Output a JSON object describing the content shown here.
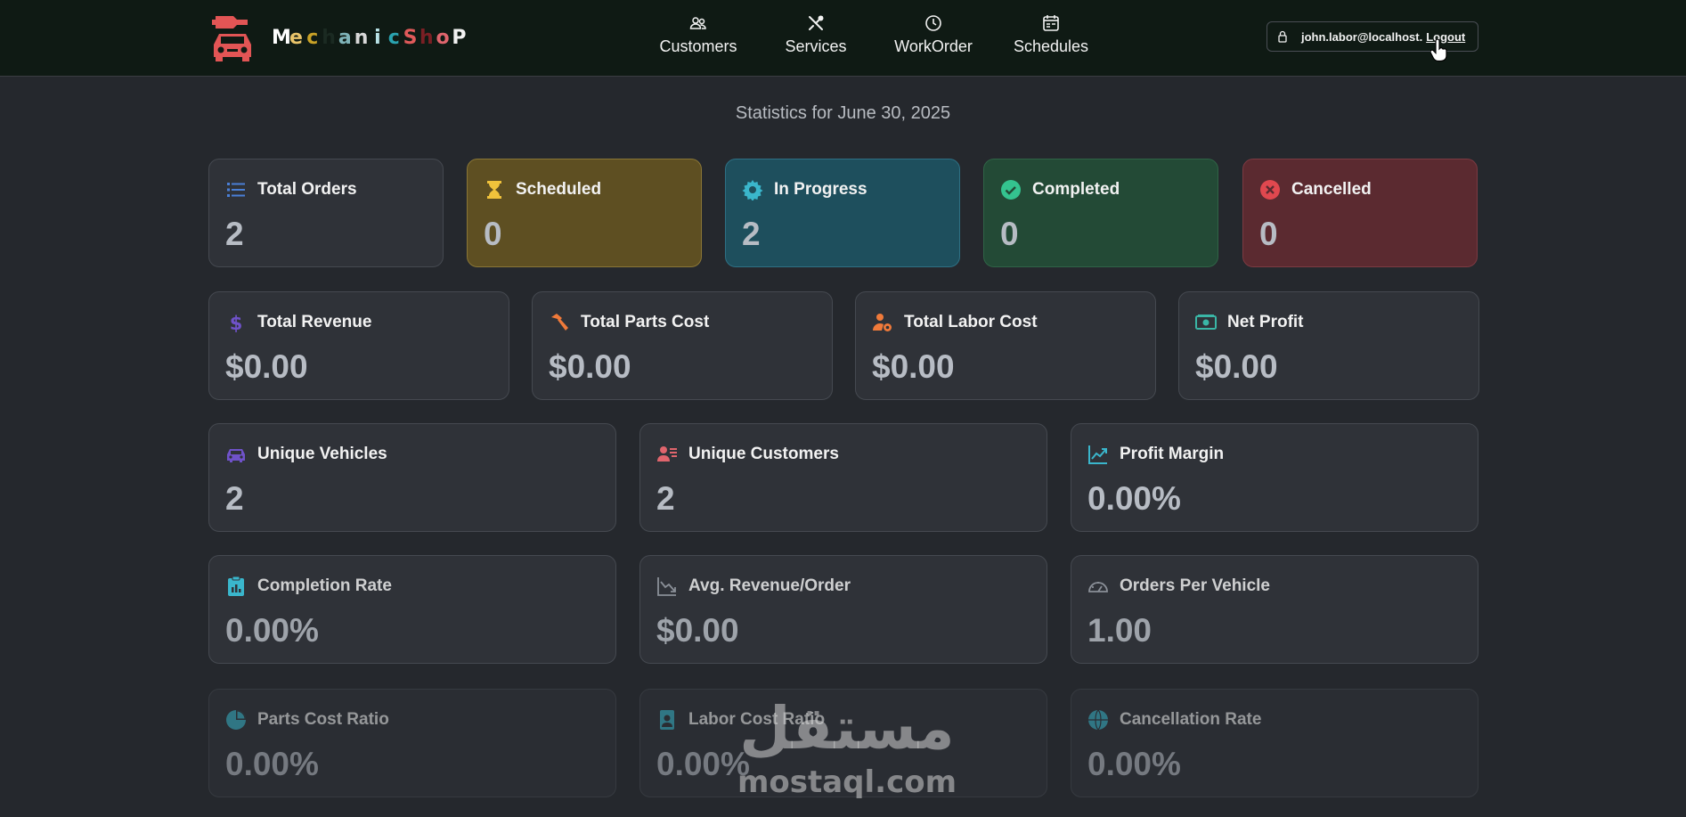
{
  "brand": {
    "letters": [
      {
        "ch": "M",
        "color": "#ffffff"
      },
      {
        "ch": "e",
        "color": "#e9c46a"
      },
      {
        "ch": "c",
        "color": "#c9a227"
      },
      {
        "ch": "h",
        "color": "#1b2a22"
      },
      {
        "ch": "a",
        "color": "#7fb3b8"
      },
      {
        "ch": "n",
        "color": "#d8d8d8"
      },
      {
        "ch": "i",
        "color": "#b9e2e6"
      },
      {
        "ch": "c",
        "color": "#2aa3b0"
      },
      {
        "ch": "S",
        "color": "#e05a5a"
      },
      {
        "ch": "h",
        "color": "#7a1f24"
      },
      {
        "ch": "o",
        "color": "#e0656d"
      },
      {
        "ch": "P",
        "color": "#f2f2f2"
      }
    ],
    "logo_color": "#e25555"
  },
  "nav": {
    "items": [
      {
        "label": "Customers",
        "icon": "users-icon"
      },
      {
        "label": "Services",
        "icon": "tools-icon"
      },
      {
        "label": "WorkOrder",
        "icon": "clock-icon"
      },
      {
        "label": "Schedules",
        "icon": "calendar-icon"
      }
    ]
  },
  "user": {
    "email": "john.labor@localhost.",
    "logout_label": "Logout",
    "icon": "lock-icon"
  },
  "page": {
    "title": "Statistics for June 30, 2025"
  },
  "cards": {
    "total_orders": {
      "title": "Total Orders",
      "value": "2",
      "icon": "list-icon",
      "icon_color": "#4a7fd6"
    },
    "scheduled": {
      "title": "Scheduled",
      "value": "0",
      "icon": "hourglass-icon",
      "icon_color": "#f0c23b"
    },
    "in_progress": {
      "title": "In Progress",
      "value": "2",
      "icon": "gear-icon",
      "icon_color": "#3ab6cc"
    },
    "completed": {
      "title": "Completed",
      "value": "0",
      "icon": "check-circle-icon",
      "icon_color": "#34c38f"
    },
    "cancelled": {
      "title": "Cancelled",
      "value": "0",
      "icon": "x-circle-icon",
      "icon_color": "#e0484f"
    },
    "total_revenue": {
      "title": "Total Revenue",
      "value": "$0.00",
      "icon": "dollar-icon",
      "icon_color": "#6f52c9"
    },
    "total_parts_cost": {
      "title": "Total Parts Cost",
      "value": "$0.00",
      "icon": "hammer-icon",
      "icon_color": "#f07a3a"
    },
    "total_labor_cost": {
      "title": "Total Labor Cost",
      "value": "$0.00",
      "icon": "worker-gear-icon",
      "icon_color": "#f07a3a"
    },
    "net_profit": {
      "title": "Net Profit",
      "value": "$0.00",
      "icon": "cash-icon",
      "icon_color": "#3ab6a6"
    },
    "unique_vehicles": {
      "title": "Unique Vehicles",
      "value": "2",
      "icon": "car-icon",
      "icon_color": "#6f52c9"
    },
    "unique_customers": {
      "title": "Unique Customers",
      "value": "2",
      "icon": "person-card-icon",
      "icon_color": "#e0656d"
    },
    "profit_margin": {
      "title": "Profit Margin",
      "value": "0.00%",
      "icon": "trend-up-icon",
      "icon_color": "#3ab6cc"
    },
    "completion_rate": {
      "title": "Completion Rate",
      "value": "0.00%",
      "icon": "clipboard-chart-icon",
      "icon_color": "#3ab6cc"
    },
    "avg_revenue_order": {
      "title": "Avg. Revenue/Order",
      "value": "$0.00",
      "icon": "trend-down-icon",
      "icon_color": "#8a8f97"
    },
    "orders_per_vehicle": {
      "title": "Orders Per Vehicle",
      "value": "1.00",
      "icon": "speedometer-icon",
      "icon_color": "#8a8f97"
    },
    "parts_cost_ratio": {
      "title": "Parts Cost Ratio",
      "value": "0.00%",
      "icon": "pie-chart-icon",
      "icon_color": "#3ab6cc"
    },
    "labor_cost_ratio": {
      "title": "Labor Cost Ratio",
      "value": "0.00%",
      "icon": "person-badge-icon",
      "icon_color": "#3ab6cc"
    },
    "cancellation_rate": {
      "title": "Cancellation Rate",
      "value": "0.00%",
      "icon": "globe-icon",
      "icon_color": "#3ab6cc"
    }
  },
  "watermark": {
    "arabic": "مستقل",
    "latin": "mostaql.com"
  }
}
